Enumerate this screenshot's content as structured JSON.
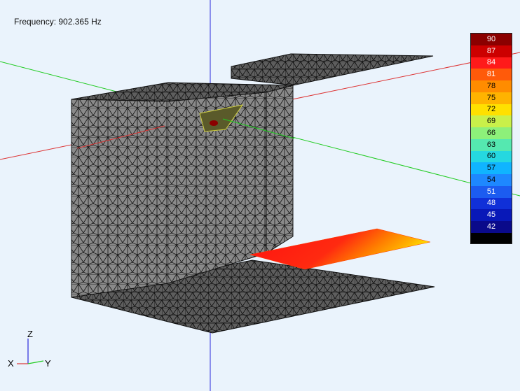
{
  "header": {
    "frequency_text": "Frequency: 902.365 Hz"
  },
  "colorbar": {
    "labels": [
      "90",
      "87",
      "84",
      "81",
      "78",
      "75",
      "72",
      "69",
      "66",
      "63",
      "60",
      "57",
      "54",
      "51",
      "48",
      "45",
      "42"
    ],
    "colors": [
      "#8b0000",
      "#cc0000",
      "#ff1a1a",
      "#ff5a0a",
      "#ff8c00",
      "#ffb300",
      "#ffe000",
      "#c9f04a",
      "#8df07a",
      "#55e8b0",
      "#25d8e0",
      "#10b4ff",
      "#1e88ff",
      "#1c5cf0",
      "#1030d8",
      "#0818b8",
      "#0a0a8a"
    ],
    "label_colors": [
      "#fff",
      "#fff",
      "#fff",
      "#fff",
      "#000",
      "#000",
      "#000",
      "#000",
      "#000",
      "#000",
      "#000",
      "#000",
      "#000",
      "#fff",
      "#fff",
      "#fff",
      "#fff"
    ]
  },
  "axes_triad": {
    "z_label": "Z",
    "x_label": "X",
    "y_label": "Y"
  }
}
